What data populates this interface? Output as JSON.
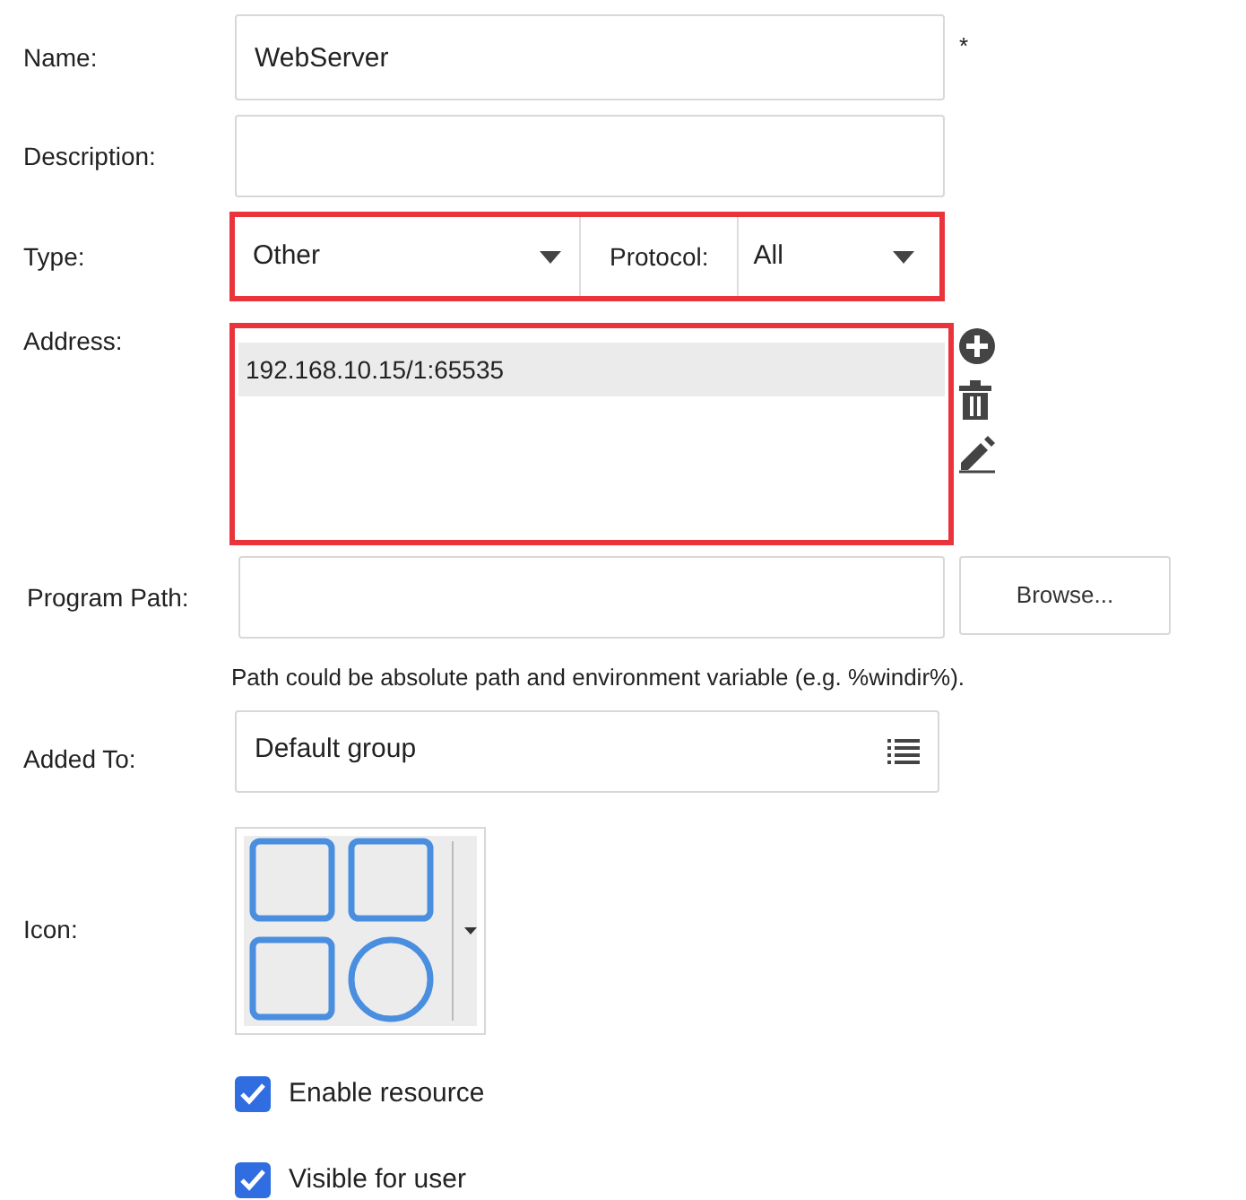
{
  "name": {
    "label": "Name:",
    "value": "WebServer",
    "required_mark": "*"
  },
  "description": {
    "label": "Description:"
  },
  "type": {
    "label": "Type:",
    "value": "Other",
    "highlighted": true
  },
  "protocol": {
    "label": "Protocol:",
    "value": "All"
  },
  "address": {
    "label": "Address:",
    "highlighted": true,
    "items": [
      {
        "text": "192.168.10.15/1:65535",
        "selected": true
      }
    ]
  },
  "program_path": {
    "label": "Program Path:",
    "button": "Browse...",
    "hint": "Path could be absolute path and environment variable (e.g. %windir%)."
  },
  "added_to": {
    "label": "Added To:",
    "value": "Default group"
  },
  "icon": {
    "label": "Icon:"
  },
  "checkboxes": [
    {
      "label": "Enable resource",
      "checked": true
    },
    {
      "label": "Visible for user",
      "checked": true
    }
  ]
}
